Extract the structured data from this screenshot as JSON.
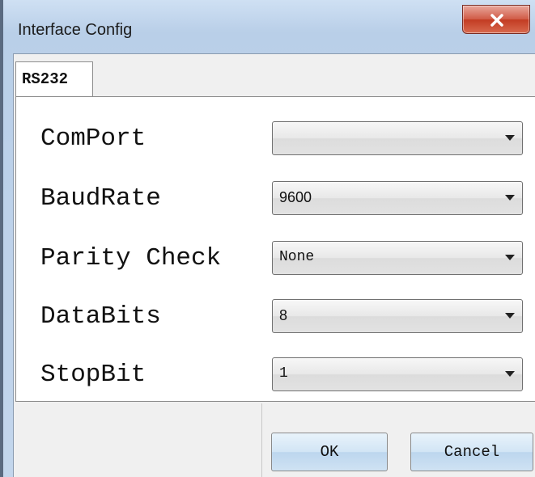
{
  "window": {
    "title": "Interface Config"
  },
  "tabs": [
    {
      "label": "RS232",
      "active": true
    }
  ],
  "fields": [
    {
      "label": "ComPort",
      "value": ""
    },
    {
      "label": "BaudRate",
      "value": "9600"
    },
    {
      "label": "Parity Check",
      "value": "None"
    },
    {
      "label": "DataBits",
      "value": "8"
    },
    {
      "label": "StopBit",
      "value": "1"
    }
  ],
  "buttons": {
    "ok_label": "OK",
    "cancel_label": "Cancel"
  },
  "icons": {
    "close": "close-icon",
    "dropdown": "chevron-down-icon"
  },
  "colors": {
    "close_button": "#c9462f",
    "title_bar": "#bcd2ea",
    "button_face": "#cfe2f3"
  }
}
